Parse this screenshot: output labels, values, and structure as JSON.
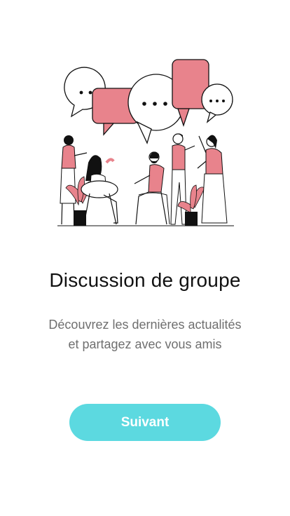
{
  "onboarding": {
    "illustration_icon": "group-discussion-illustration",
    "title": "Discussion de groupe",
    "subtitle_line1": "Découvrez les dernières actualités",
    "subtitle_line2": "et partagez avec vous amis",
    "next_button_label": "Suivant"
  },
  "colors": {
    "accent": "#5cd9e0",
    "illustration_pink": "#e8838c",
    "title": "#111111",
    "subtitle": "#6f6f6f",
    "background": "#ffffff"
  }
}
